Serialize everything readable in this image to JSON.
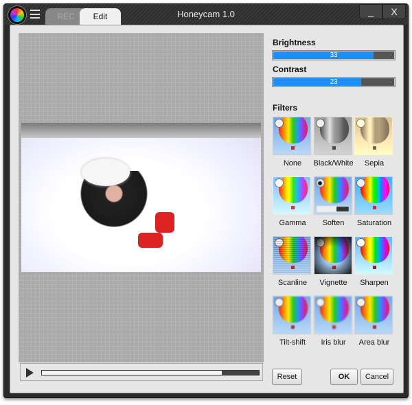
{
  "window": {
    "title": "Honeycam 1.0",
    "tabs": [
      {
        "label": "REC",
        "active": false
      },
      {
        "label": "Edit",
        "active": true
      }
    ],
    "minimize": "_",
    "close": "X"
  },
  "adjust": {
    "brightness": {
      "label": "Brightness",
      "value": 33,
      "fill": 0.83
    },
    "contrast": {
      "label": "Contrast",
      "value": 23,
      "fill": 0.73
    },
    "accent": "#1a8fff"
  },
  "filters": {
    "label": "Filters",
    "items": [
      {
        "label": "None",
        "selected": false
      },
      {
        "label": "Black/White",
        "selected": false
      },
      {
        "label": "Sepia",
        "selected": false
      },
      {
        "label": "Gamma",
        "selected": false
      },
      {
        "label": "Soften",
        "selected": true,
        "strength": 0.62
      },
      {
        "label": "Saturation",
        "selected": false
      },
      {
        "label": "Scanline",
        "selected": false
      },
      {
        "label": "Vignette",
        "selected": false
      },
      {
        "label": "Sharpen",
        "selected": false
      },
      {
        "label": "Tilt-shift",
        "selected": false
      },
      {
        "label": "Iris blur",
        "selected": false
      },
      {
        "label": "Area blur",
        "selected": false
      }
    ]
  },
  "player": {
    "progress": 0.83
  },
  "buttons": {
    "reset": "Reset",
    "ok": "OK",
    "cancel": "Cancel"
  }
}
